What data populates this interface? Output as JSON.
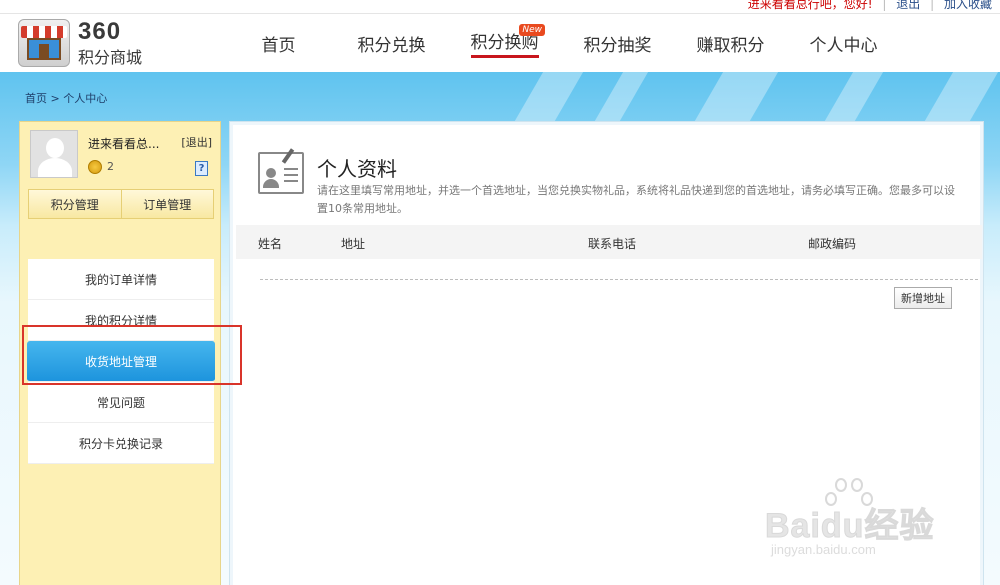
{
  "topbar": {
    "greeting": "进来看看总行吧，您好!",
    "logout": "退出",
    "favorite": "加入收藏"
  },
  "header": {
    "logo_number": "360",
    "logo_subtitle": "积分商城",
    "nav": [
      {
        "label": "首页"
      },
      {
        "label": "积分兑换"
      },
      {
        "label": "积分换购",
        "badge": "New",
        "active": true
      },
      {
        "label": "积分抽奖"
      },
      {
        "label": "赚取积分"
      },
      {
        "label": "个人中心"
      }
    ]
  },
  "breadcrumb": {
    "home": "首页",
    "separator": ">",
    "current": "个人中心"
  },
  "sidebar": {
    "username": "进来看看总...",
    "logout": "[退出]",
    "points": "2",
    "help": "?",
    "tabs": [
      "积分管理",
      "订单管理"
    ],
    "menu": [
      {
        "label": "我的订单详情"
      },
      {
        "label": "我的积分详情"
      },
      {
        "label": "收货地址管理",
        "active": true
      },
      {
        "label": "常见问题"
      },
      {
        "label": "积分卡兑换记录"
      }
    ]
  },
  "main": {
    "title": "个人资料",
    "description": "请在这里填写常用地址，并选一个首选地址，当您兑换实物礼品，系统将礼品快递到您的首选地址，请务必填写正确。您最多可以设置10条常用地址。",
    "columns": [
      "姓名",
      "地址",
      "联系电话",
      "邮政编码"
    ],
    "add_button": "新增地址"
  },
  "watermark": {
    "brand": "Baidu经验",
    "url": "jingyan.baidu.com"
  },
  "colors": {
    "accent_blue": "#1d94dd",
    "nav_underline": "#c8161d",
    "sidebar_bg": "#fdf0b4",
    "highlight_red": "#d9342a"
  }
}
